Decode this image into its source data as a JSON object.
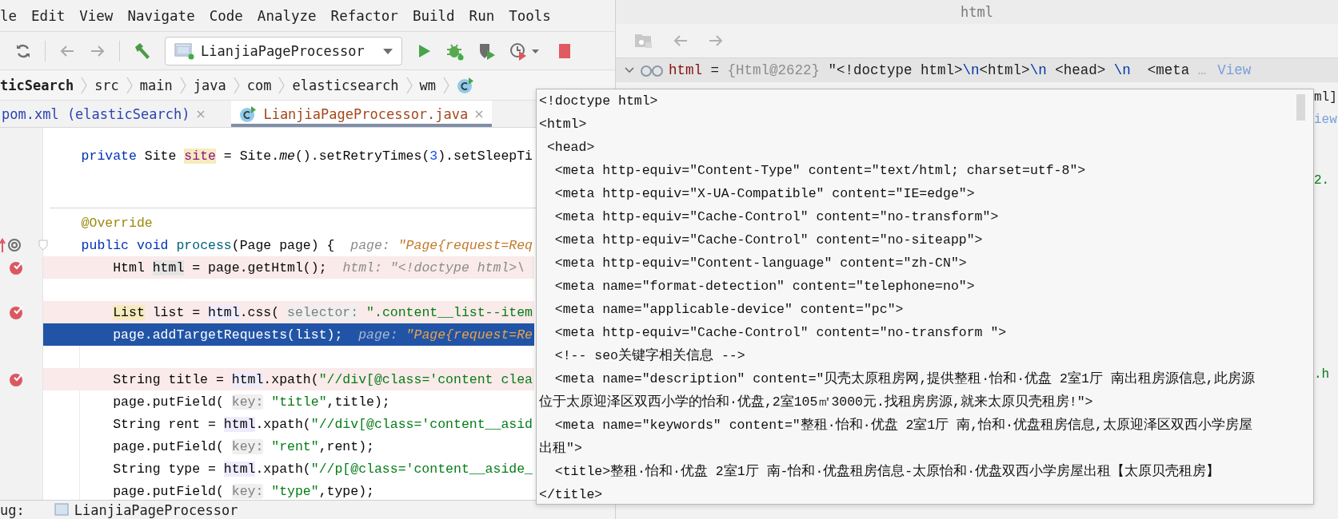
{
  "menu": [
    "le",
    "Edit",
    "View",
    "Navigate",
    "Code",
    "Analyze",
    "Refactor",
    "Build",
    "Run",
    "Tools"
  ],
  "toolbar": {
    "run_config": "LianjiaPageProcessor"
  },
  "breadcrumbs": {
    "items": [
      "ticSearch",
      "src",
      "main",
      "java",
      "com",
      "elasticsearch",
      "wm"
    ]
  },
  "tabs": [
    {
      "label": "pom.xml (elasticSearch)",
      "selected": false,
      "kind": "xml"
    },
    {
      "label": "LianjiaPageProcessor.java",
      "selected": true,
      "kind": "class"
    }
  ],
  "editor": {
    "lines": [
      {
        "kind": "code",
        "breakpoint": false,
        "current": false,
        "tokens": [
          {
            "kind": "kw",
            "text": "private "
          },
          {
            "kind": "pl",
            "text": "Site "
          },
          {
            "kind": "fh",
            "text": "site"
          },
          {
            "kind": "pl",
            "text": " = Site."
          },
          {
            "kind": "it",
            "text": "me"
          },
          {
            "kind": "pl",
            "text": "().setRetryTimes("
          },
          {
            "kind": "num",
            "text": "3"
          },
          {
            "kind": "pl",
            "text": ").setSleepTi"
          }
        ]
      },
      {
        "kind": "blank"
      },
      {
        "kind": "separator"
      },
      {
        "kind": "code",
        "breakpoint": false,
        "current": false,
        "tokens": [
          {
            "kind": "ann",
            "text": "@Override"
          }
        ]
      },
      {
        "kind": "code",
        "breakpoint": false,
        "current": false,
        "gutter_icon": {
          "kind": "override"
        },
        "tokens": [
          {
            "kind": "kw",
            "text": "public void "
          },
          {
            "kind": "fn",
            "text": "process"
          },
          {
            "kind": "pl",
            "text": "(Page page) {  "
          },
          {
            "kind": "hn",
            "text": "page: "
          },
          {
            "kind": "hv",
            "text": "\"Page{request=Req"
          }
        ],
        "children": [
          {
            "kind": "code",
            "breakpoint": true,
            "current": false,
            "tokens": [
              {
                "kind": "pl",
                "text": "Html "
              },
              {
                "kind": "dh",
                "text": "html"
              },
              {
                "kind": "pl",
                "text": " = page.getHtml();  "
              },
              {
                "kind": "hn",
                "text": "html: \"<!doctype html>\\"
              }
            ]
          },
          {
            "kind": "blank"
          },
          {
            "kind": "code",
            "breakpoint": true,
            "current": false,
            "tokens": [
              {
                "kind": "th",
                "text": "List"
              },
              {
                "kind": "pl",
                "text": " list = "
              },
              {
                "kind": "us",
                "text": "html"
              },
              {
                "kind": "pl",
                "text": ".css( "
              },
              {
                "kind": "pm",
                "text": "selector:"
              },
              {
                "kind": "str",
                "text": " \".content__list--item"
              }
            ]
          },
          {
            "kind": "code",
            "breakpoint": false,
            "current": true,
            "tokens": [
              {
                "kind": "pl",
                "text": "page.addTargetRequests(list);  "
              },
              {
                "kind": "hn",
                "text": "page: "
              },
              {
                "kind": "hv",
                "text": "\"Page{request=Re"
              }
            ]
          },
          {
            "kind": "blank"
          },
          {
            "kind": "code",
            "breakpoint": true,
            "current": false,
            "tokens": [
              {
                "kind": "pl",
                "text": "String title = "
              },
              {
                "kind": "us",
                "text": "html"
              },
              {
                "kind": "pl",
                "text": ".xpath("
              },
              {
                "kind": "str",
                "text": "\"//div[@class='content clea"
              }
            ]
          },
          {
            "kind": "code",
            "breakpoint": false,
            "current": false,
            "tokens": [
              {
                "kind": "pl",
                "text": "page.putField( "
              },
              {
                "kind": "pm",
                "text": "key:"
              },
              {
                "kind": "str",
                "text": " \"title\""
              },
              {
                "kind": "pl",
                "text": ",title);"
              }
            ]
          },
          {
            "kind": "code",
            "breakpoint": false,
            "current": false,
            "tokens": [
              {
                "kind": "pl",
                "text": "String rent = "
              },
              {
                "kind": "us",
                "text": "html"
              },
              {
                "kind": "pl",
                "text": ".xpath("
              },
              {
                "kind": "str",
                "text": "\"//div[@class='content__asid"
              }
            ]
          },
          {
            "kind": "code",
            "breakpoint": false,
            "current": false,
            "tokens": [
              {
                "kind": "pl",
                "text": "page.putField( "
              },
              {
                "kind": "pm",
                "text": "key:"
              },
              {
                "kind": "str",
                "text": " \"rent\""
              },
              {
                "kind": "pl",
                "text": ",rent);"
              }
            ]
          },
          {
            "kind": "code",
            "breakpoint": false,
            "current": false,
            "tokens": [
              {
                "kind": "pl",
                "text": "String type = "
              },
              {
                "kind": "us",
                "text": "html"
              },
              {
                "kind": "pl",
                "text": ".xpath("
              },
              {
                "kind": "str",
                "text": "\"//p[@class='content__aside_"
              }
            ]
          },
          {
            "kind": "code",
            "breakpoint": false,
            "current": false,
            "tokens": [
              {
                "kind": "pl",
                "text": "page.putField( "
              },
              {
                "kind": "pm",
                "text": "key:"
              },
              {
                "kind": "str",
                "text": " \"type\""
              },
              {
                "kind": "pl",
                "text": ",type);"
              }
            ]
          }
        ]
      }
    ]
  },
  "debug_bar": {
    "label": "ug:",
    "session": "LianjiaPageProcessor"
  },
  "evaluate_window": {
    "title": "html",
    "variable": {
      "tokens": [
        {
          "kind": "name",
          "text": "html"
        },
        {
          "kind": "op",
          "text": " = "
        },
        {
          "kind": "type",
          "text": "{Html@2622} "
        },
        {
          "kind": "s",
          "text": "\"<!doctype html>"
        },
        {
          "kind": "esc",
          "text": "\\n"
        },
        {
          "kind": "s",
          "text": "<html>"
        },
        {
          "kind": "esc",
          "text": "\\n"
        },
        {
          "kind": "s",
          "text": " <head> "
        },
        {
          "kind": "esc",
          "text": "\\n"
        },
        {
          "kind": "s",
          "text": "  <meta "
        },
        {
          "kind": "dim",
          "text": "…"
        }
      ],
      "link": "View"
    },
    "fragments": [
      {
        "kind": "pl",
        "text": "ml]"
      },
      {
        "kind": "link",
        "text": "iew"
      },
      {
        "kind": "str",
        "text": "2."
      },
      {
        "kind": "str",
        "text": ".h"
      }
    ]
  },
  "value_popup": {
    "lines": [
      "<!doctype html>",
      "<html>",
      " <head>",
      "  <meta http-equiv=\"Content-Type\" content=\"text/html; charset=utf-8\">",
      "  <meta http-equiv=\"X-UA-Compatible\" content=\"IE=edge\">",
      "  <meta http-equiv=\"Cache-Control\" content=\"no-transform\">",
      "  <meta http-equiv=\"Cache-Control\" content=\"no-siteapp\">",
      "  <meta http-equiv=\"Content-language\" content=\"zh-CN\">",
      "  <meta name=\"format-detection\" content=\"telephone=no\">",
      "  <meta name=\"applicable-device\" content=\"pc\">",
      "  <meta http-equiv=\"Cache-Control\" content=\"no-transform \">",
      "  <!-- seo关键字相关信息 -->",
      "  <meta name=\"description\" content=\"贝壳太原租房网,提供整租·怡和·优盘 2室1厅 南出租房源信息,此房源",
      "位于太原迎泽区双西小学的怡和·优盘,2室105㎡3000元.找租房房源,就来太原贝壳租房!\">",
      "  <meta name=\"keywords\" content=\"整租·怡和·优盘 2室1厅 南,怡和·优盘租房信息,太原迎泽区双西小学房屋",
      "出租\">",
      "  <title>整租·怡和·优盘 2室1厅 南-怡和·优盘租房信息-太原怡和·优盘双西小学房屋出租【太原贝壳租房】",
      "</title>"
    ]
  }
}
